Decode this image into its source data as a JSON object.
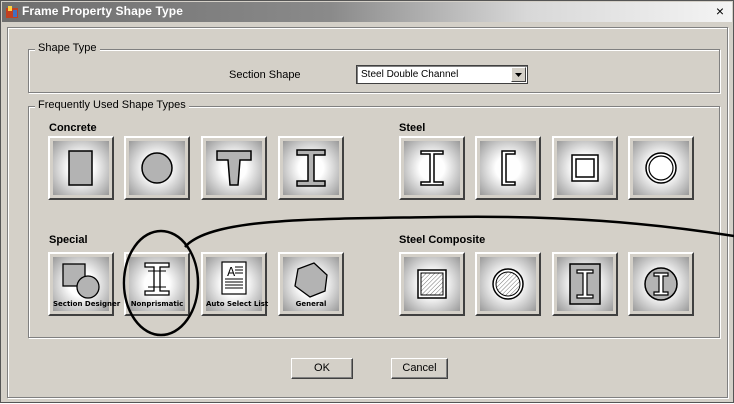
{
  "window": {
    "title": "Frame Property Shape Type",
    "close_glyph": "×"
  },
  "shape_type": {
    "group_label": "Shape Type",
    "section_shape_label": "Section Shape",
    "section_shape_value": "Steel Double Channel"
  },
  "frequent": {
    "group_label": "Frequently Used Shape Types",
    "categories": {
      "concrete": "Concrete",
      "steel": "Steel",
      "special": "Special",
      "steel_composite": "Steel Composite"
    },
    "special_captions": [
      "Section Designer",
      "Nonprismatic",
      "Auto Select List",
      "General"
    ],
    "auto_select_glyph": "A"
  },
  "buttons": {
    "ok": "OK",
    "cancel": "Cancel"
  },
  "colors": {
    "face": "#d4d0c8",
    "shadow": "#404040",
    "highlight": "#ffffff",
    "shape_fill": "#b3b3b3"
  }
}
